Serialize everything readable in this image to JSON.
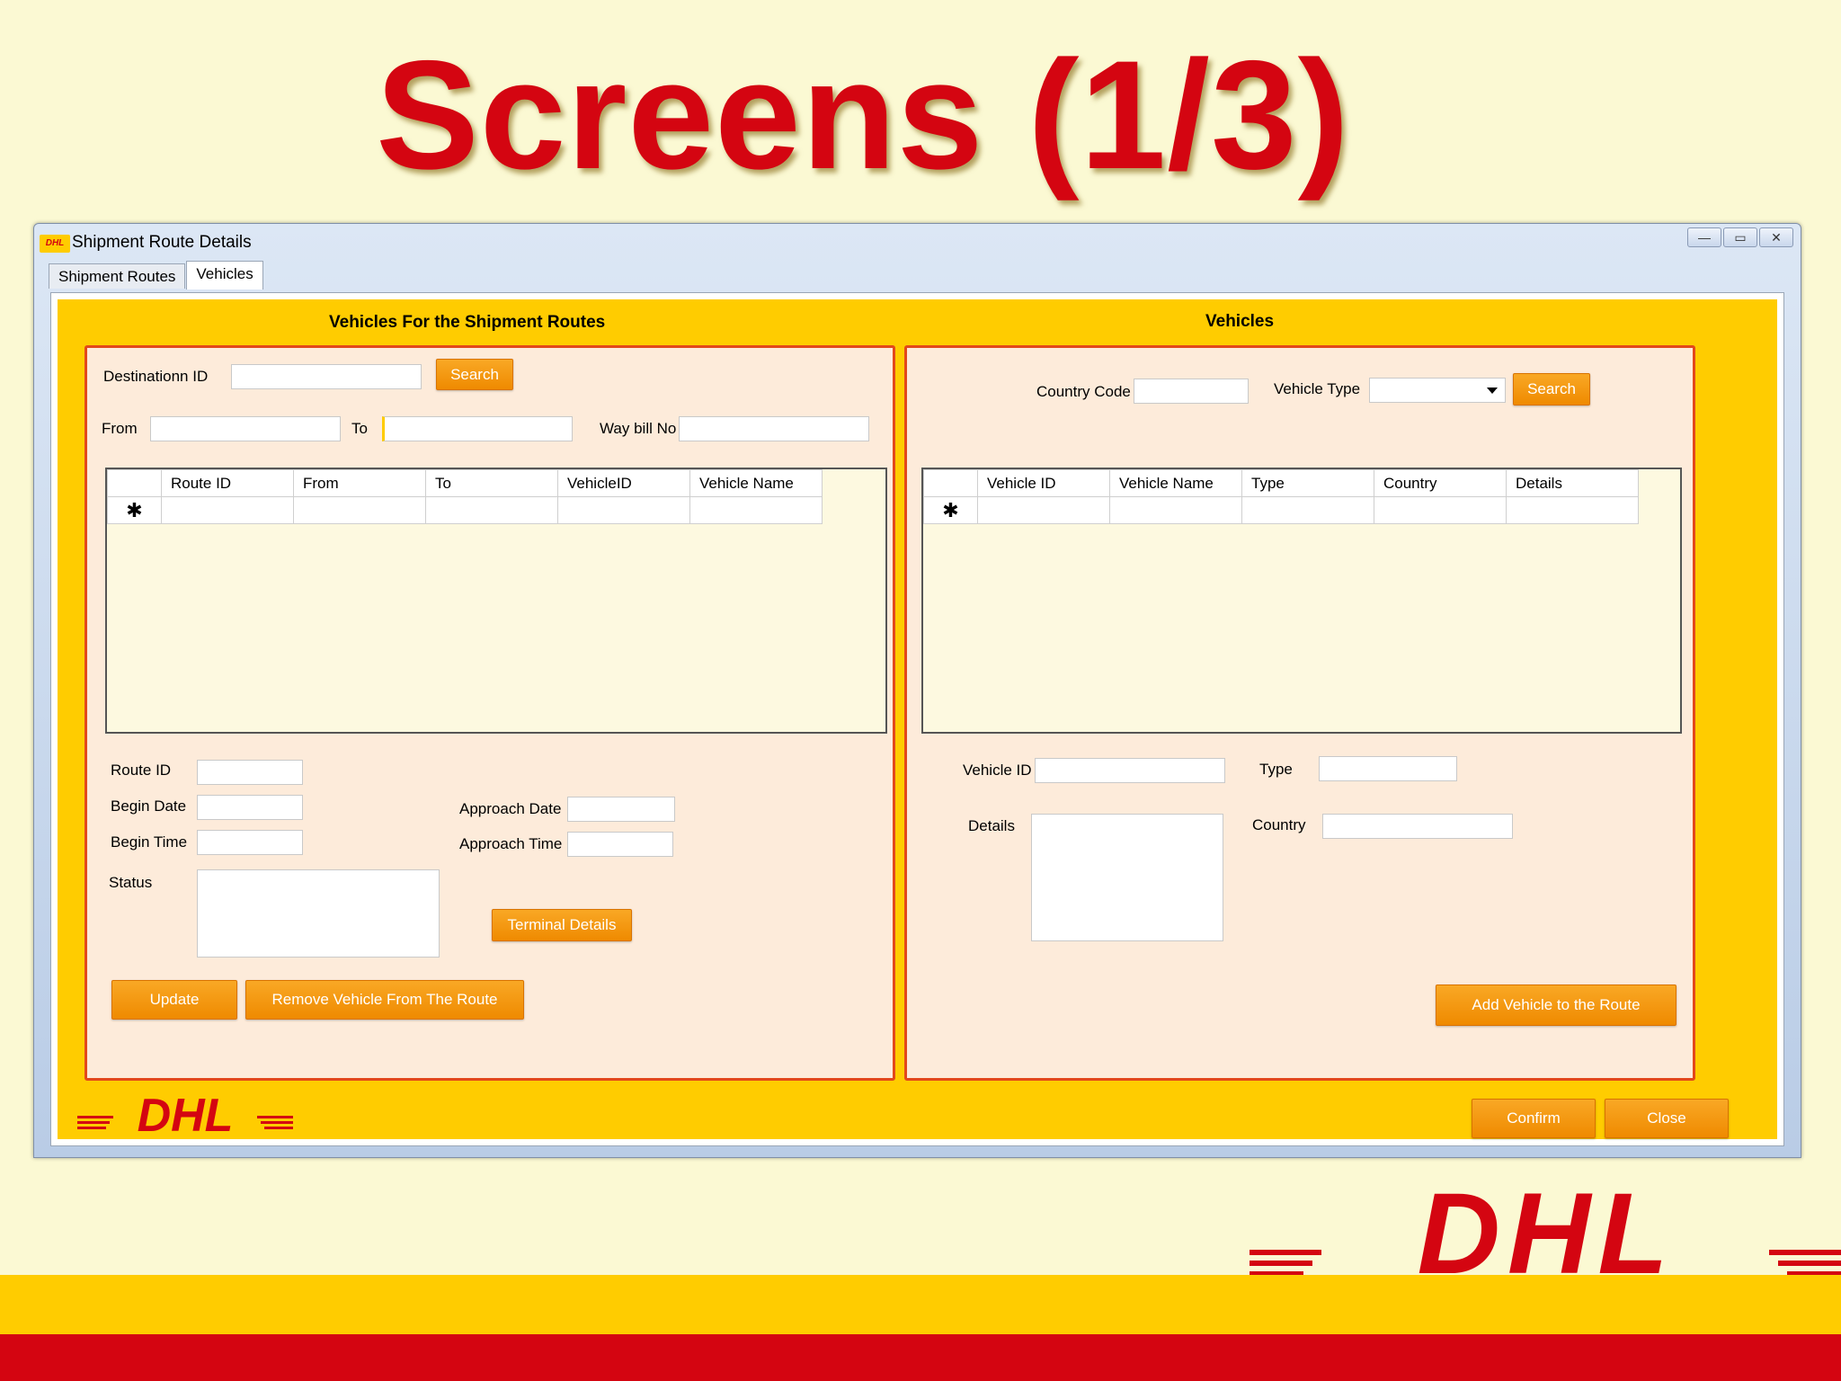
{
  "slide": {
    "title": "Screens (1/3)"
  },
  "window": {
    "title": "Shipment Route Details",
    "controls": [
      "—",
      "▭",
      "✕"
    ],
    "tabs": [
      {
        "label": "Shipment Routes"
      },
      {
        "label": "Vehicles"
      }
    ],
    "active_tab": "Vehicles"
  },
  "left": {
    "title": "Vehicles For the Shipment Routes",
    "destination_label": "Destinationn ID",
    "search_label": "Search",
    "from_label": "From",
    "to_label": "To",
    "waybill_label": "Way bill No",
    "columns": [
      "Route ID",
      "From",
      "To",
      "VehicleID",
      "Vehicle Name"
    ],
    "new_row_marker": "✱",
    "route_id_label": "Route ID",
    "begin_date_label": "Begin Date",
    "begin_time_label": "Begin Time",
    "approach_date_label": "Approach Date",
    "approach_time_label": "Approach Time",
    "status_label": "Status",
    "terminal_details_label": "Terminal Details",
    "update_label": "Update",
    "remove_vehicle_label": "Remove Vehicle From The Route"
  },
  "right": {
    "title": "Vehicles",
    "country_code_label": "Country Code",
    "vehicle_type_label": "Vehicle Type",
    "search_label": "Search",
    "columns": [
      "Vehicle ID",
      "Vehicle Name",
      "Type",
      "Country",
      "Details"
    ],
    "new_row_marker": "✱",
    "vehicle_id_label": "Vehicle ID",
    "type_label": "Type",
    "details_label": "Details",
    "country_label": "Country",
    "add_vehicle_label": "Add Vehicle to the Route"
  },
  "footer": {
    "confirm_label": "Confirm",
    "close_label": "Close"
  },
  "brand": {
    "logo_text": "DHL",
    "red": "#D40511",
    "yellow": "#FFCC00",
    "orange": "#EF8A00"
  }
}
